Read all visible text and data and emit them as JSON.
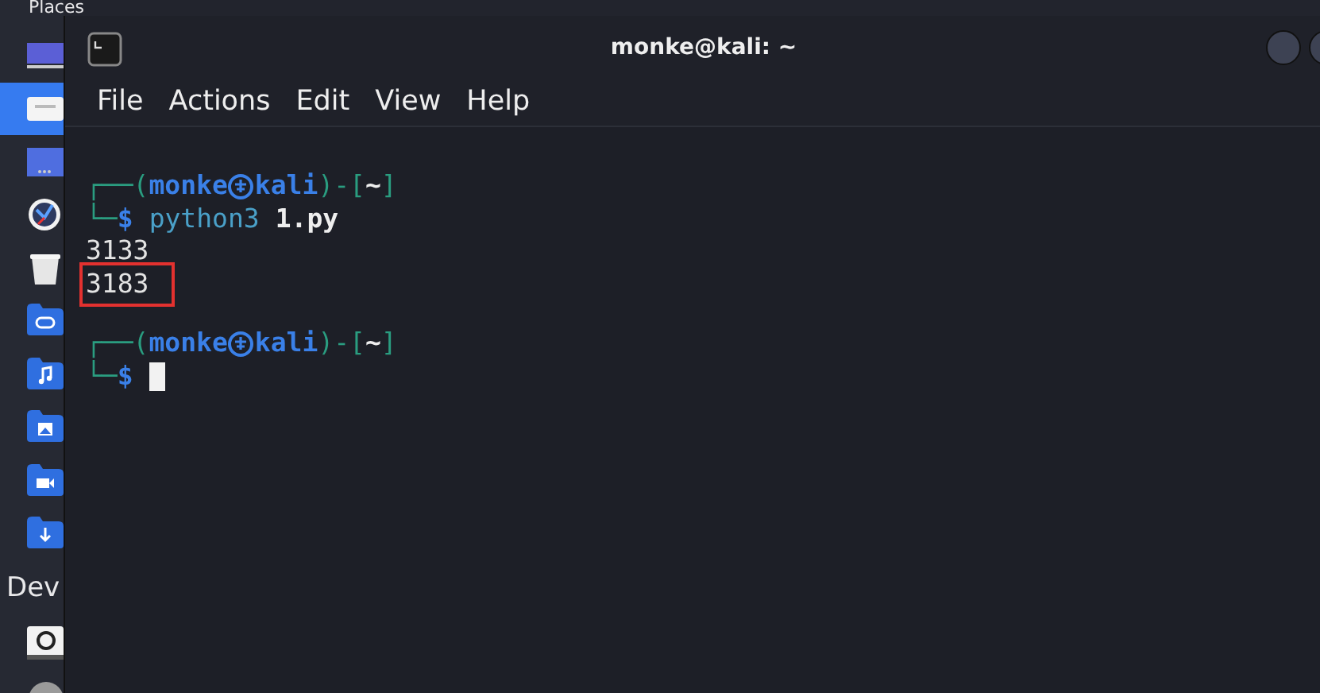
{
  "file_manager": {
    "sidebar": [
      {
        "heading": "Places",
        "items": [
          {
            "kind": "computer",
            "selected": false
          },
          {
            "kind": "home",
            "selected": true
          },
          {
            "kind": "desktop",
            "selected": false
          },
          {
            "kind": "recent",
            "selected": false
          },
          {
            "kind": "trash",
            "selected": false
          },
          {
            "kind": "documents",
            "selected": false
          },
          {
            "kind": "music",
            "selected": false
          },
          {
            "kind": "pictures",
            "selected": false
          },
          {
            "kind": "videos",
            "selected": false
          },
          {
            "kind": "downloads",
            "selected": false
          }
        ]
      },
      {
        "heading": "Dev",
        "items": [
          {
            "kind": "drive",
            "selected": false
          },
          {
            "kind": "disc",
            "selected": false
          }
        ]
      }
    ]
  },
  "terminal": {
    "title": "monke@kali: ~",
    "menu": [
      "File",
      "Actions",
      "Edit",
      "View",
      "Help"
    ],
    "lines": [
      {
        "kind": "prompt",
        "segments": [
          {
            "kind": "frame",
            "text": "┌──("
          },
          {
            "kind": "user",
            "text": "monke"
          },
          {
            "kind": "symbol"
          },
          {
            "kind": "user",
            "text": "kali"
          },
          {
            "kind": "frame",
            "text": ")-["
          },
          {
            "kind": "dir",
            "text": "~"
          },
          {
            "kind": "frame",
            "text": "]"
          }
        ]
      },
      {
        "kind": "input",
        "segments": [
          {
            "kind": "frame",
            "text": "└─"
          },
          {
            "kind": "sign",
            "text": "$"
          },
          {
            "kind": "command",
            "text": "python3"
          },
          {
            "kind": "arg",
            "text": "1.py"
          }
        ],
        "cursor": false
      },
      {
        "kind": "output",
        "text": "3133",
        "highlighted": false
      },
      {
        "kind": "output",
        "text": "3183",
        "highlighted": true
      },
      {
        "kind": "blank"
      },
      {
        "kind": "prompt",
        "segments": [
          {
            "kind": "frame",
            "text": "┌──("
          },
          {
            "kind": "user",
            "text": "monke"
          },
          {
            "kind": "symbol"
          },
          {
            "kind": "user",
            "text": "kali"
          },
          {
            "kind": "frame",
            "text": ")-["
          },
          {
            "kind": "dir",
            "text": "~"
          },
          {
            "kind": "frame",
            "text": "]"
          }
        ]
      },
      {
        "kind": "input",
        "segments": [
          {
            "kind": "frame",
            "text": "└─"
          },
          {
            "kind": "sign",
            "text": "$"
          }
        ],
        "cursor": true
      }
    ]
  }
}
